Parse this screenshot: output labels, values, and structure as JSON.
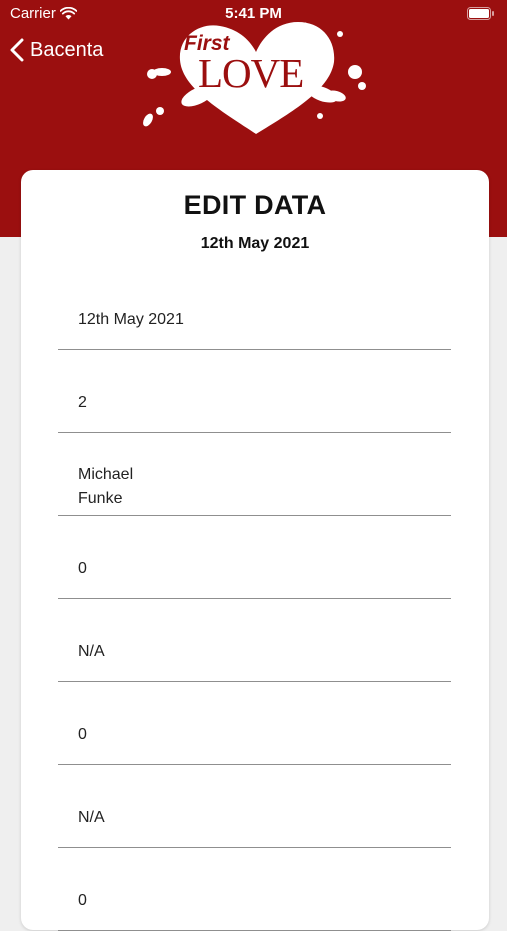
{
  "status_bar": {
    "carrier": "Carrier",
    "time": "5:41 PM"
  },
  "nav": {
    "back_label": "Bacenta"
  },
  "logo": {
    "line1": "First",
    "line2": "LOVE"
  },
  "card": {
    "title": "EDIT DATA",
    "date": "12th May 2021"
  },
  "fields": [
    "12th May 2021",
    "2",
    "Michael\nFunke",
    "0",
    "N/A",
    "0",
    "N/A",
    "0"
  ],
  "colors": {
    "header": "#9b0f0f",
    "background": "#efefef"
  }
}
